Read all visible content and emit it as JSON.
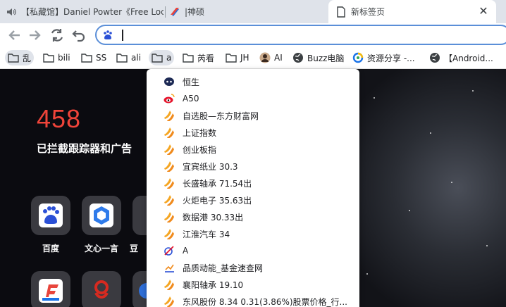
{
  "tabs": [
    {
      "label": "【私藏馆】Daniel Powter《Free Loc",
      "icon": "speaker-icon",
      "active": false
    },
    {
      "label": "|神硕",
      "icon": "shenshuo-favicon-icon",
      "active": false
    },
    {
      "label": "新标签页",
      "icon": "document-icon",
      "active": true
    }
  ],
  "tab_close_glyph": "✕",
  "omnibox": {
    "value": "",
    "placeholder": "",
    "engine_icon": "baidu-paw-icon"
  },
  "bookmarks": [
    {
      "label": "乱",
      "icon": "folder-icon",
      "active": true
    },
    {
      "label": "bili",
      "icon": "folder-icon"
    },
    {
      "label": "SS",
      "icon": "folder-icon"
    },
    {
      "label": "ali",
      "icon": "folder-icon"
    },
    {
      "label": "a",
      "icon": "folder-icon",
      "active": true
    },
    {
      "label": "芮看",
      "icon": "folder-icon"
    },
    {
      "label": "JH",
      "icon": "folder-icon"
    },
    {
      "label": "AI",
      "icon": "avatar-icon"
    },
    {
      "label": "Buzz电脑",
      "icon": "globe-icon"
    },
    {
      "label": "资源分享 -...",
      "icon": "circle-logo-icon"
    },
    {
      "label": "【Android...",
      "icon": "globe-icon"
    }
  ],
  "folder_menu": [
    {
      "label": "恒生",
      "icon": "mascot-icon"
    },
    {
      "label": "A50",
      "icon": "weibo-icon"
    },
    {
      "label": "自选股—东方财富网",
      "icon": "eastmoney-icon"
    },
    {
      "label": "上证指数",
      "icon": "eastmoney-icon"
    },
    {
      "label": "创业板指",
      "icon": "eastmoney-icon"
    },
    {
      "label": "宜宾纸业 30.3",
      "icon": "eastmoney-icon"
    },
    {
      "label": "长盛轴承 71.54出",
      "icon": "eastmoney-icon"
    },
    {
      "label": "火炬电子 35.63出",
      "icon": "eastmoney-icon"
    },
    {
      "label": "数据港 30.33出",
      "icon": "eastmoney-icon"
    },
    {
      "label": "江淮汽车 34",
      "icon": "eastmoney-icon"
    },
    {
      "label": "A",
      "icon": "swoosh-icon"
    },
    {
      "label": "品质动能_基金速查网",
      "icon": "chart-mini-icon"
    },
    {
      "label": "襄阳轴承 19.10",
      "icon": "eastmoney-icon"
    },
    {
      "label": "东风股份 8.34 0.31(3.86%)股票价格_行...",
      "icon": "eastmoney-icon"
    }
  ],
  "newtab": {
    "blocked_count": "458",
    "blocked_label": "已拦截跟踪器和广告",
    "tiles": [
      {
        "label": "百度",
        "icon": "baidu-tile-icon"
      },
      {
        "label": "文心一言",
        "icon": "wenxin-tile-icon"
      },
      {
        "label": "豆",
        "icon": "partial-tile-icon"
      }
    ],
    "tiles_row2": [
      {
        "label": "",
        "icon": "f-logo-tile-icon"
      },
      {
        "label": "",
        "icon": "red-dragon-tile-icon"
      },
      {
        "label": "",
        "icon": "blue-circle-tile-icon"
      }
    ]
  },
  "colors": {
    "accent": "#5b8fd8",
    "blocked": "#f0443a",
    "eastmoney": "#f5a623"
  }
}
